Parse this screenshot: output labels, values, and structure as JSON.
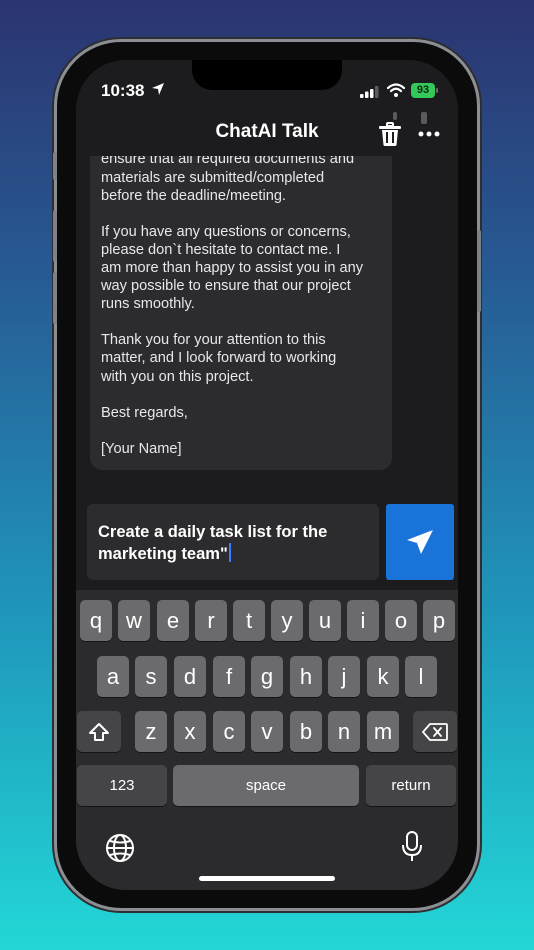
{
  "status_bar": {
    "time": "10:38",
    "battery": "93"
  },
  "header": {
    "title": "ChatAI Talk"
  },
  "message": {
    "text": "ensure that all required documents and\nmaterials are submitted/completed\nbefore the deadline/meeting.\n\nIf you have any questions or concerns,\nplease don`t hesitate to contact me. I\nam more than happy to assist you in any\nway possible to ensure that our project\nruns smoothly.\n\nThank you for your attention to this\nmatter, and I look forward to working\nwith you on this project.\n\nBest regards,\n\n[Your Name]"
  },
  "composer": {
    "value": "Create a daily task list for the\nmarketing team\""
  },
  "keyboard": {
    "row1": [
      "q",
      "w",
      "e",
      "r",
      "t",
      "y",
      "u",
      "i",
      "o",
      "p"
    ],
    "row2": [
      "a",
      "s",
      "d",
      "f",
      "g",
      "h",
      "j",
      "k",
      "l"
    ],
    "row3": [
      "z",
      "x",
      "c",
      "v",
      "b",
      "n",
      "m"
    ],
    "numbers_label": "123",
    "space_label": "space",
    "return_label": "return"
  },
  "colors": {
    "accent": "#1a73d9",
    "battery": "#34c759",
    "bubble": "#2c2c2e"
  }
}
